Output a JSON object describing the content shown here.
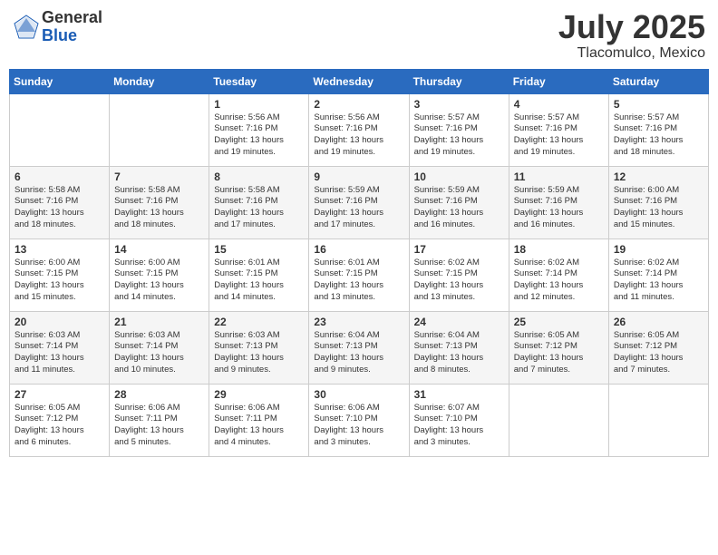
{
  "header": {
    "logo_general": "General",
    "logo_blue": "Blue",
    "month_year": "July 2025",
    "location": "Tlacomulco, Mexico"
  },
  "weekdays": [
    "Sunday",
    "Monday",
    "Tuesday",
    "Wednesday",
    "Thursday",
    "Friday",
    "Saturday"
  ],
  "weeks": [
    [
      {
        "day": "",
        "info": ""
      },
      {
        "day": "",
        "info": ""
      },
      {
        "day": "1",
        "info": "Sunrise: 5:56 AM\nSunset: 7:16 PM\nDaylight: 13 hours\nand 19 minutes."
      },
      {
        "day": "2",
        "info": "Sunrise: 5:56 AM\nSunset: 7:16 PM\nDaylight: 13 hours\nand 19 minutes."
      },
      {
        "day": "3",
        "info": "Sunrise: 5:57 AM\nSunset: 7:16 PM\nDaylight: 13 hours\nand 19 minutes."
      },
      {
        "day": "4",
        "info": "Sunrise: 5:57 AM\nSunset: 7:16 PM\nDaylight: 13 hours\nand 19 minutes."
      },
      {
        "day": "5",
        "info": "Sunrise: 5:57 AM\nSunset: 7:16 PM\nDaylight: 13 hours\nand 18 minutes."
      }
    ],
    [
      {
        "day": "6",
        "info": "Sunrise: 5:58 AM\nSunset: 7:16 PM\nDaylight: 13 hours\nand 18 minutes."
      },
      {
        "day": "7",
        "info": "Sunrise: 5:58 AM\nSunset: 7:16 PM\nDaylight: 13 hours\nand 18 minutes."
      },
      {
        "day": "8",
        "info": "Sunrise: 5:58 AM\nSunset: 7:16 PM\nDaylight: 13 hours\nand 17 minutes."
      },
      {
        "day": "9",
        "info": "Sunrise: 5:59 AM\nSunset: 7:16 PM\nDaylight: 13 hours\nand 17 minutes."
      },
      {
        "day": "10",
        "info": "Sunrise: 5:59 AM\nSunset: 7:16 PM\nDaylight: 13 hours\nand 16 minutes."
      },
      {
        "day": "11",
        "info": "Sunrise: 5:59 AM\nSunset: 7:16 PM\nDaylight: 13 hours\nand 16 minutes."
      },
      {
        "day": "12",
        "info": "Sunrise: 6:00 AM\nSunset: 7:16 PM\nDaylight: 13 hours\nand 15 minutes."
      }
    ],
    [
      {
        "day": "13",
        "info": "Sunrise: 6:00 AM\nSunset: 7:15 PM\nDaylight: 13 hours\nand 15 minutes."
      },
      {
        "day": "14",
        "info": "Sunrise: 6:00 AM\nSunset: 7:15 PM\nDaylight: 13 hours\nand 14 minutes."
      },
      {
        "day": "15",
        "info": "Sunrise: 6:01 AM\nSunset: 7:15 PM\nDaylight: 13 hours\nand 14 minutes."
      },
      {
        "day": "16",
        "info": "Sunrise: 6:01 AM\nSunset: 7:15 PM\nDaylight: 13 hours\nand 13 minutes."
      },
      {
        "day": "17",
        "info": "Sunrise: 6:02 AM\nSunset: 7:15 PM\nDaylight: 13 hours\nand 13 minutes."
      },
      {
        "day": "18",
        "info": "Sunrise: 6:02 AM\nSunset: 7:14 PM\nDaylight: 13 hours\nand 12 minutes."
      },
      {
        "day": "19",
        "info": "Sunrise: 6:02 AM\nSunset: 7:14 PM\nDaylight: 13 hours\nand 11 minutes."
      }
    ],
    [
      {
        "day": "20",
        "info": "Sunrise: 6:03 AM\nSunset: 7:14 PM\nDaylight: 13 hours\nand 11 minutes."
      },
      {
        "day": "21",
        "info": "Sunrise: 6:03 AM\nSunset: 7:14 PM\nDaylight: 13 hours\nand 10 minutes."
      },
      {
        "day": "22",
        "info": "Sunrise: 6:03 AM\nSunset: 7:13 PM\nDaylight: 13 hours\nand 9 minutes."
      },
      {
        "day": "23",
        "info": "Sunrise: 6:04 AM\nSunset: 7:13 PM\nDaylight: 13 hours\nand 9 minutes."
      },
      {
        "day": "24",
        "info": "Sunrise: 6:04 AM\nSunset: 7:13 PM\nDaylight: 13 hours\nand 8 minutes."
      },
      {
        "day": "25",
        "info": "Sunrise: 6:05 AM\nSunset: 7:12 PM\nDaylight: 13 hours\nand 7 minutes."
      },
      {
        "day": "26",
        "info": "Sunrise: 6:05 AM\nSunset: 7:12 PM\nDaylight: 13 hours\nand 7 minutes."
      }
    ],
    [
      {
        "day": "27",
        "info": "Sunrise: 6:05 AM\nSunset: 7:12 PM\nDaylight: 13 hours\nand 6 minutes."
      },
      {
        "day": "28",
        "info": "Sunrise: 6:06 AM\nSunset: 7:11 PM\nDaylight: 13 hours\nand 5 minutes."
      },
      {
        "day": "29",
        "info": "Sunrise: 6:06 AM\nSunset: 7:11 PM\nDaylight: 13 hours\nand 4 minutes."
      },
      {
        "day": "30",
        "info": "Sunrise: 6:06 AM\nSunset: 7:10 PM\nDaylight: 13 hours\nand 3 minutes."
      },
      {
        "day": "31",
        "info": "Sunrise: 6:07 AM\nSunset: 7:10 PM\nDaylight: 13 hours\nand 3 minutes."
      },
      {
        "day": "",
        "info": ""
      },
      {
        "day": "",
        "info": ""
      }
    ]
  ]
}
